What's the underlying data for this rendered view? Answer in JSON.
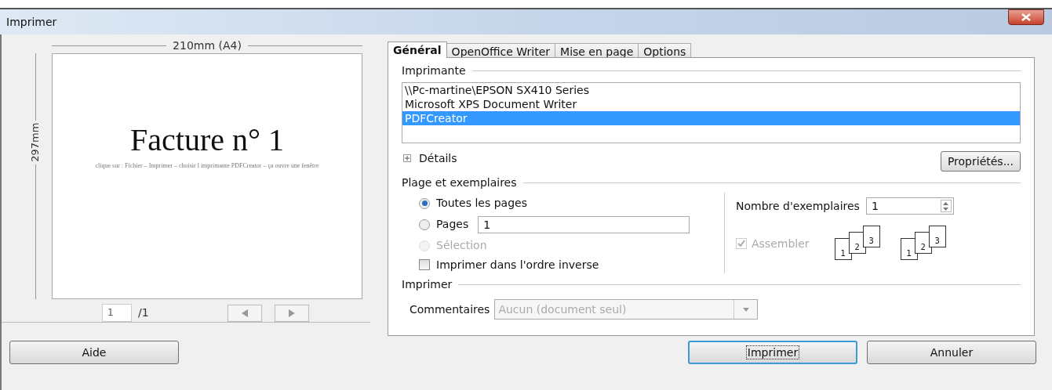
{
  "window": {
    "title": "Imprimer"
  },
  "preview": {
    "width_label": "210mm (A4)",
    "height_label": "297mm",
    "page_title": "Facture n° 1",
    "page_note": "clique sur : Fichier – Imprimer – choisir l imprimante PDFCreator – ça ouvre une fenêtre",
    "page_field": "1",
    "page_count": "/1"
  },
  "tabs": [
    {
      "label": "Général",
      "selected": true
    },
    {
      "label": "OpenOffice Writer",
      "selected": false
    },
    {
      "label": "Mise en page",
      "selected": false
    },
    {
      "label": "Options",
      "selected": false
    }
  ],
  "printer": {
    "label": "Imprimante",
    "printers": [
      {
        "name": "\\\\Pc-martine\\EPSON SX410 Series",
        "selected": false
      },
      {
        "name": "Microsoft XPS Document Writer",
        "selected": false
      },
      {
        "name": "PDFCreator",
        "selected": true
      }
    ],
    "details": {
      "label": "Détails",
      "expanded": false
    },
    "properties_button": "Propriétés..."
  },
  "range": {
    "label": "Plage et exemplaires",
    "options": [
      {
        "label": "Toutes les pages",
        "selected": true,
        "disabled": false
      },
      {
        "label": "Pages",
        "selected": false,
        "disabled": false,
        "value": "1"
      },
      {
        "label": "Sélection",
        "selected": false,
        "disabled": true
      }
    ],
    "reverse": {
      "label": "Imprimer dans l'ordre inverse",
      "checked": false
    },
    "copies": {
      "label": "Nombre d'exemplaires",
      "value": "1"
    },
    "collate": {
      "label": "Assembler",
      "checked": true,
      "disabled": true
    },
    "collate_icons": [
      [
        "1",
        "2",
        "3"
      ],
      [
        "1",
        "2",
        "3"
      ]
    ]
  },
  "print": {
    "label": "Imprimer",
    "comments_label": "Commentaires",
    "comments_value": "Aucun (document seul)",
    "disabled": true
  },
  "buttons": [
    {
      "label": "Aide",
      "default": false
    },
    {
      "label": "Imprimer",
      "default": true
    },
    {
      "label": "Annuler",
      "default": false
    }
  ]
}
